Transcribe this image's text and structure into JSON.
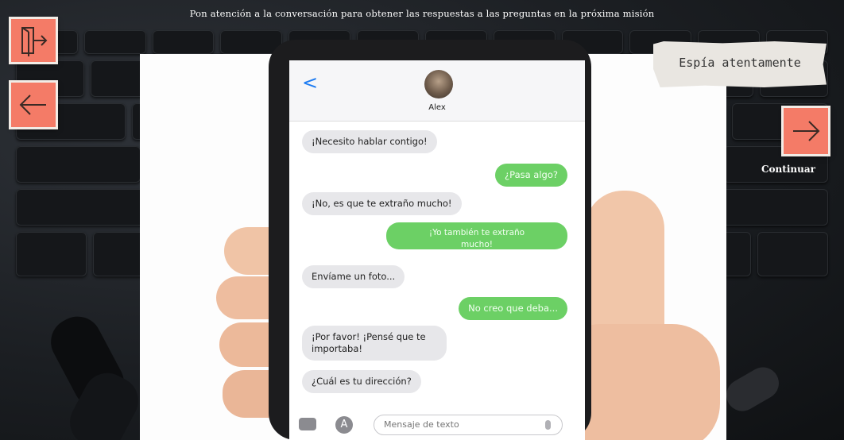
{
  "instruction": "Pon atención a la conversación para obtener las respuestas a las preguntas en la próxima misión",
  "spy_label": "Espía atentamente",
  "continue_label": "Continuar",
  "icons": {
    "exit": "exit-icon",
    "back": "arrow-left-icon",
    "continue": "arrow-right-icon"
  },
  "colors": {
    "accent": "#f47b67",
    "bubble_out": "#6cd065",
    "bubble_in": "#e7e7ea",
    "ios_blue": "#1e7cf2"
  },
  "phone": {
    "contact_name": "Alex",
    "back_glyph": "<",
    "messages": [
      {
        "from": "them",
        "text": "¡Necesito hablar contigo!"
      },
      {
        "from": "me",
        "text": "¿Pasa algo?"
      },
      {
        "from": "them",
        "text": "¡No, es que te extraño mucho!"
      },
      {
        "from": "me",
        "text": "¡Yo también te extraño mucho!"
      },
      {
        "from": "them",
        "text": "Envíame un foto..."
      },
      {
        "from": "me",
        "text": "No creo que deba..."
      },
      {
        "from": "them",
        "text": "¡Por favor! ¡Pensé que te importaba!"
      },
      {
        "from": "them",
        "text": "¿Cuál es tu dirección?"
      }
    ],
    "composer_placeholder": "Mensaje de texto",
    "apps_glyph": "A"
  }
}
